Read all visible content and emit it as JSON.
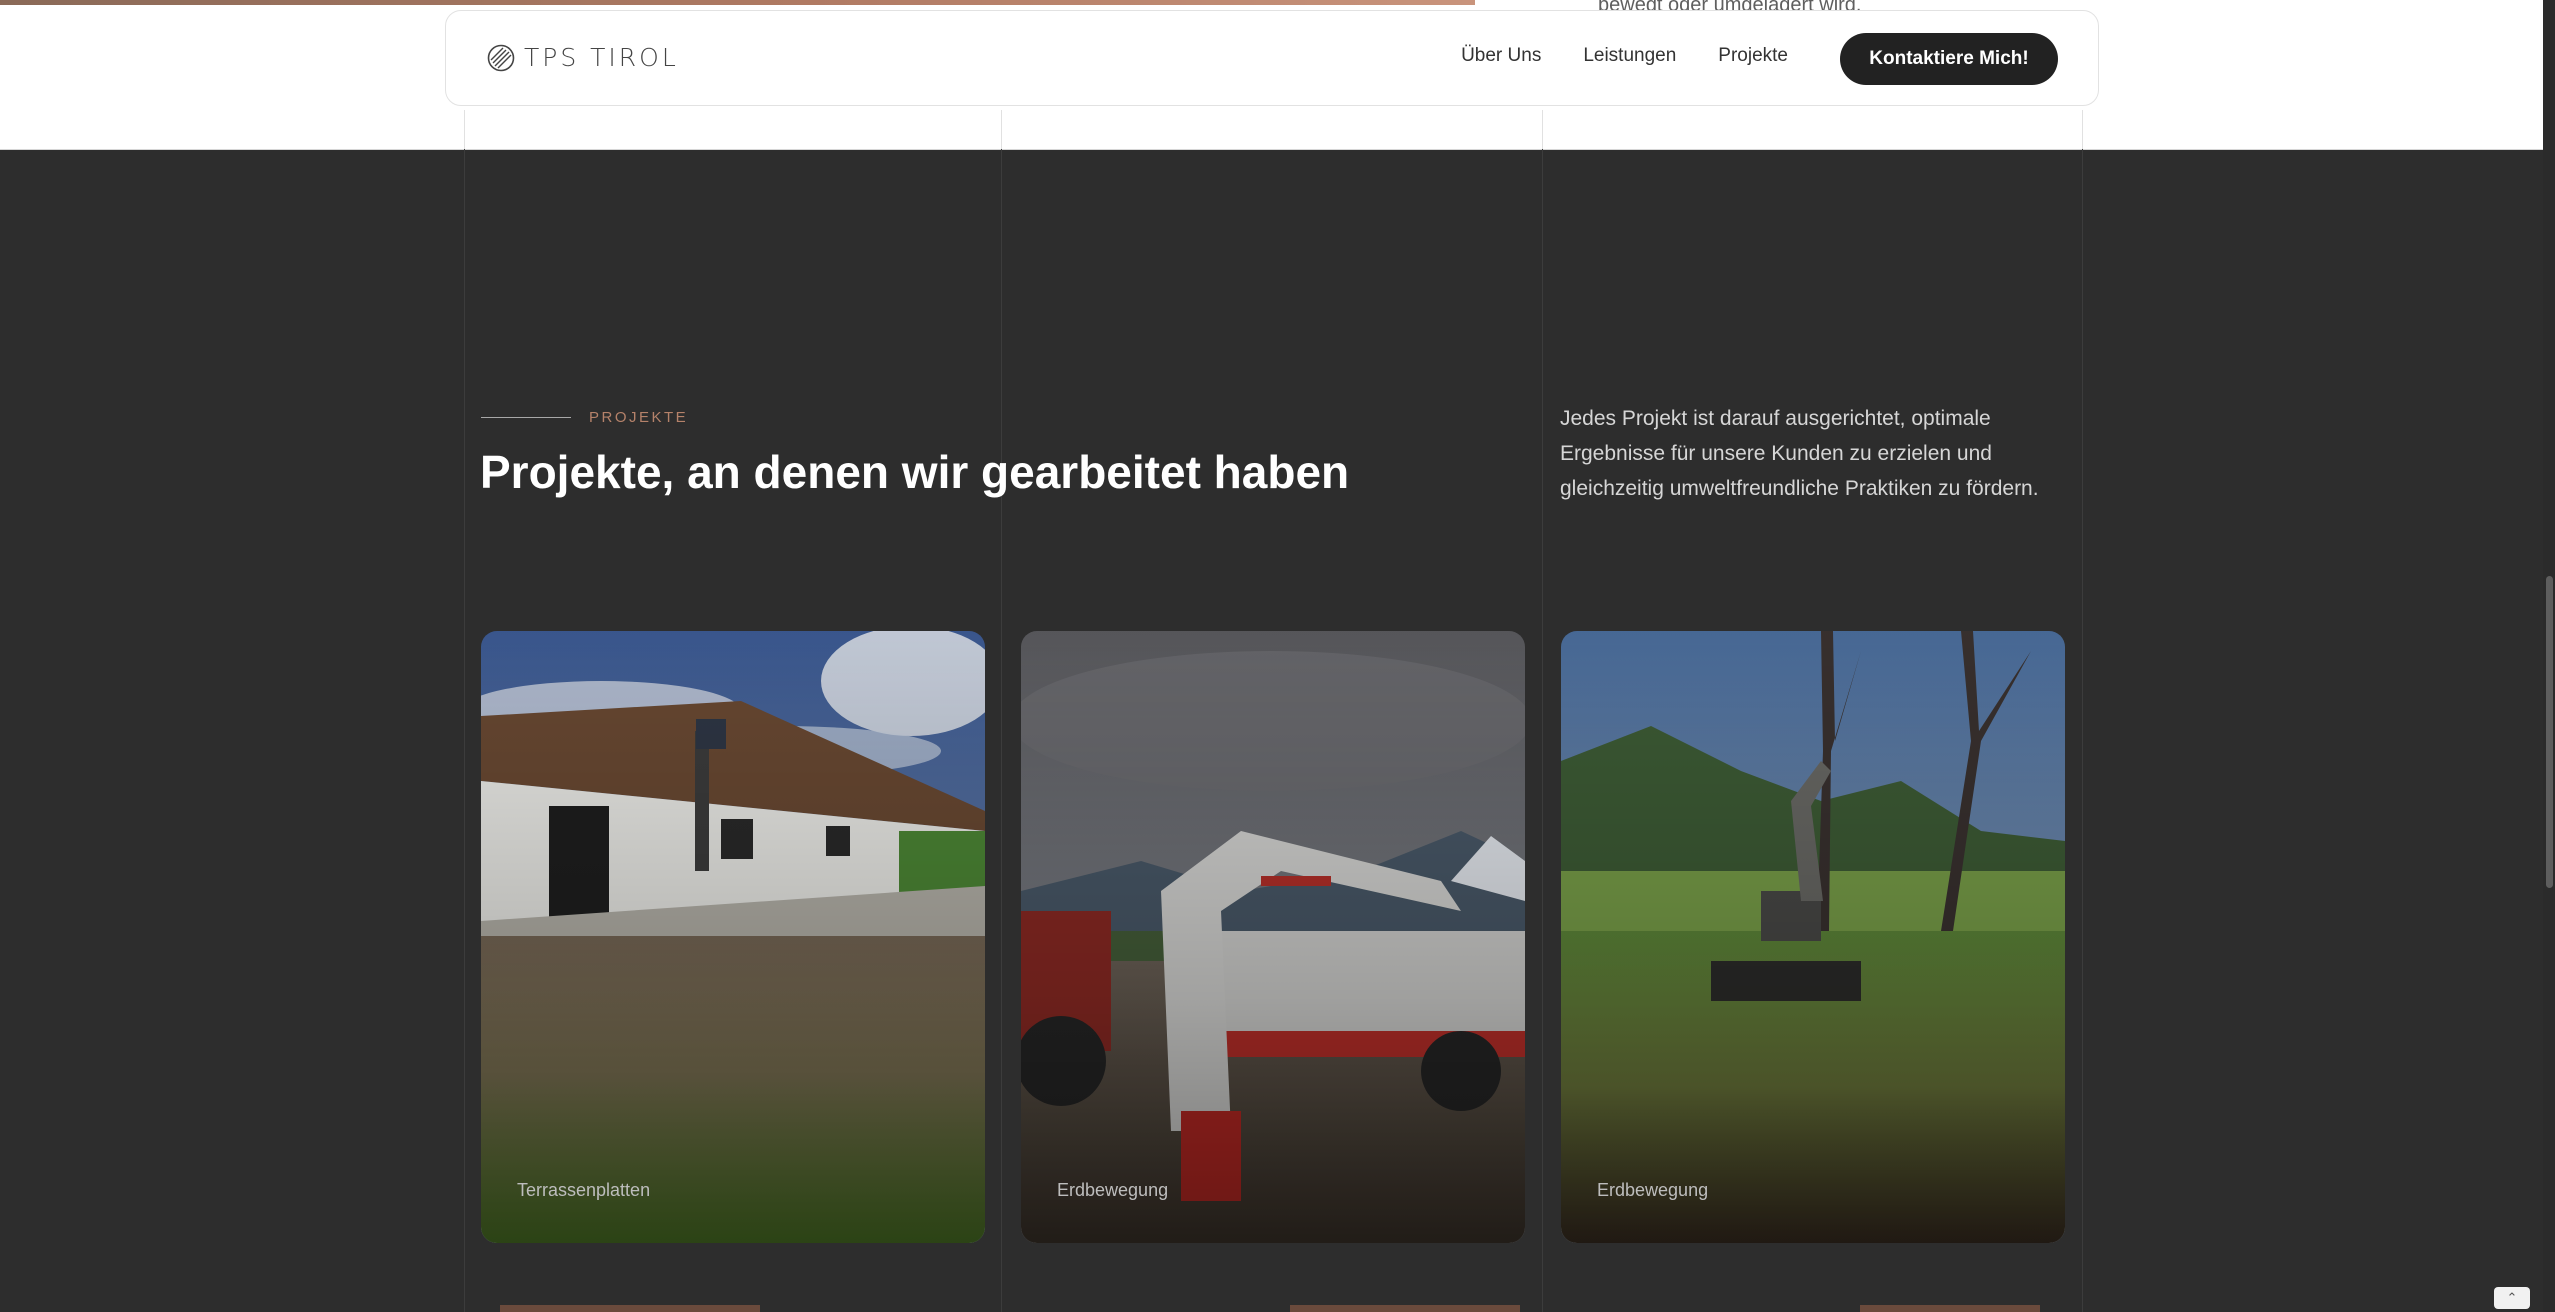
{
  "top_peek": {
    "text": "bewegt oder umgelagert wird."
  },
  "nav": {
    "logo_text": "TPS TIROL",
    "links": [
      "Über Uns",
      "Leistungen",
      "Projekte"
    ],
    "cta_label": "Kontaktiere Mich!"
  },
  "section": {
    "eyebrow": "PROJEKTE",
    "title": "Projekte, an denen wir gearbeitet haben",
    "intro": "Jedes Projekt ist darauf ausgerichtet, optimale Ergebnisse für unsere Kunden zu erzielen und gleichzeitig umweltfreundliche Praktiken zu fördern."
  },
  "projects": [
    {
      "label": "Terrassenplatten",
      "icon": "house-photo"
    },
    {
      "label": "Erdbewegung",
      "icon": "excavator-photo"
    },
    {
      "label": "Erdbewegung",
      "icon": "field-excavator-photo"
    }
  ],
  "colors": {
    "background": "#2d2d2d",
    "accent": "#b5826a",
    "cta": "#222222"
  }
}
